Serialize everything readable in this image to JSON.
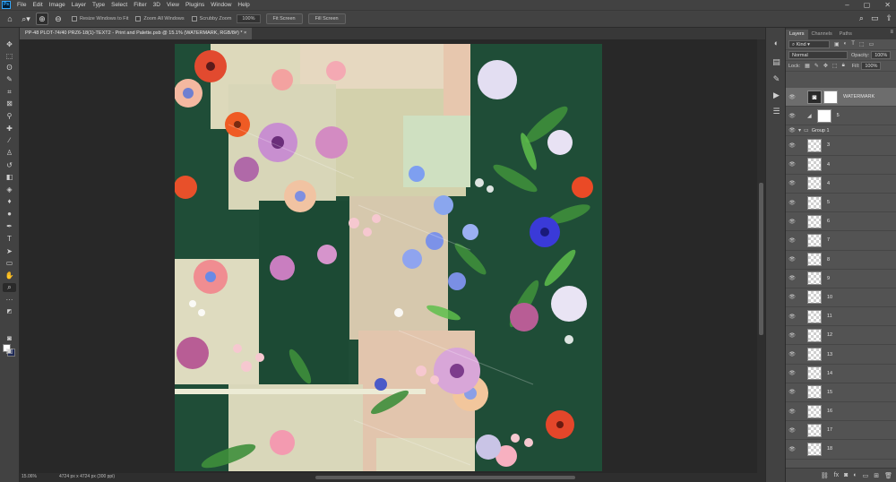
{
  "menubar": {
    "logo": "Ps",
    "items": [
      "File",
      "Edit",
      "Image",
      "Layer",
      "Type",
      "Select",
      "Filter",
      "3D",
      "View",
      "Plugins",
      "Window",
      "Help"
    ]
  },
  "options": {
    "resize_windows": "Resize Windows to Fit",
    "zoom_all": "Zoom All Windows",
    "scrubby_zoom": "Scrubby Zoom",
    "zoom_value": "100%",
    "fit_screen": "Fit Screen",
    "fill_screen": "Fill Screen"
  },
  "document": {
    "tab_title": "PP-48 PLOT-74/40 PRZ6-18(1)-TEXT2 - Print and Palette.psb @ 15.1% (WATERMARK, RGB/8#) * ×"
  },
  "layers_panel": {
    "tabs": [
      "Layers",
      "Channels",
      "Paths"
    ],
    "filter_kind": "Kind",
    "blend_mode": "Normal",
    "opacity_label": "Opacity:",
    "opacity_value": "100%",
    "lock_label": "Lock:",
    "fill_label": "Fill:",
    "fill_value": "100%",
    "layers": [
      {
        "name": "WATERMARK",
        "kind": "watermark"
      },
      {
        "name": "5",
        "kind": "white"
      },
      {
        "name": "Group 1",
        "kind": "group"
      },
      {
        "name": "3",
        "kind": "trans"
      },
      {
        "name": "4",
        "kind": "trans"
      },
      {
        "name": "4",
        "kind": "trans"
      },
      {
        "name": "5",
        "kind": "trans"
      },
      {
        "name": "6",
        "kind": "trans"
      },
      {
        "name": "7",
        "kind": "trans"
      },
      {
        "name": "8",
        "kind": "trans"
      },
      {
        "name": "9",
        "kind": "trans"
      },
      {
        "name": "10",
        "kind": "trans"
      },
      {
        "name": "11",
        "kind": "trans"
      },
      {
        "name": "12",
        "kind": "trans"
      },
      {
        "name": "13",
        "kind": "trans"
      },
      {
        "name": "14",
        "kind": "trans"
      },
      {
        "name": "15",
        "kind": "trans"
      },
      {
        "name": "16",
        "kind": "trans"
      },
      {
        "name": "17",
        "kind": "trans"
      },
      {
        "name": "18",
        "kind": "trans"
      }
    ]
  },
  "status": {
    "zoom": "15.06%",
    "doc_size": "4724 px x 4724 px (300 ppi)"
  }
}
